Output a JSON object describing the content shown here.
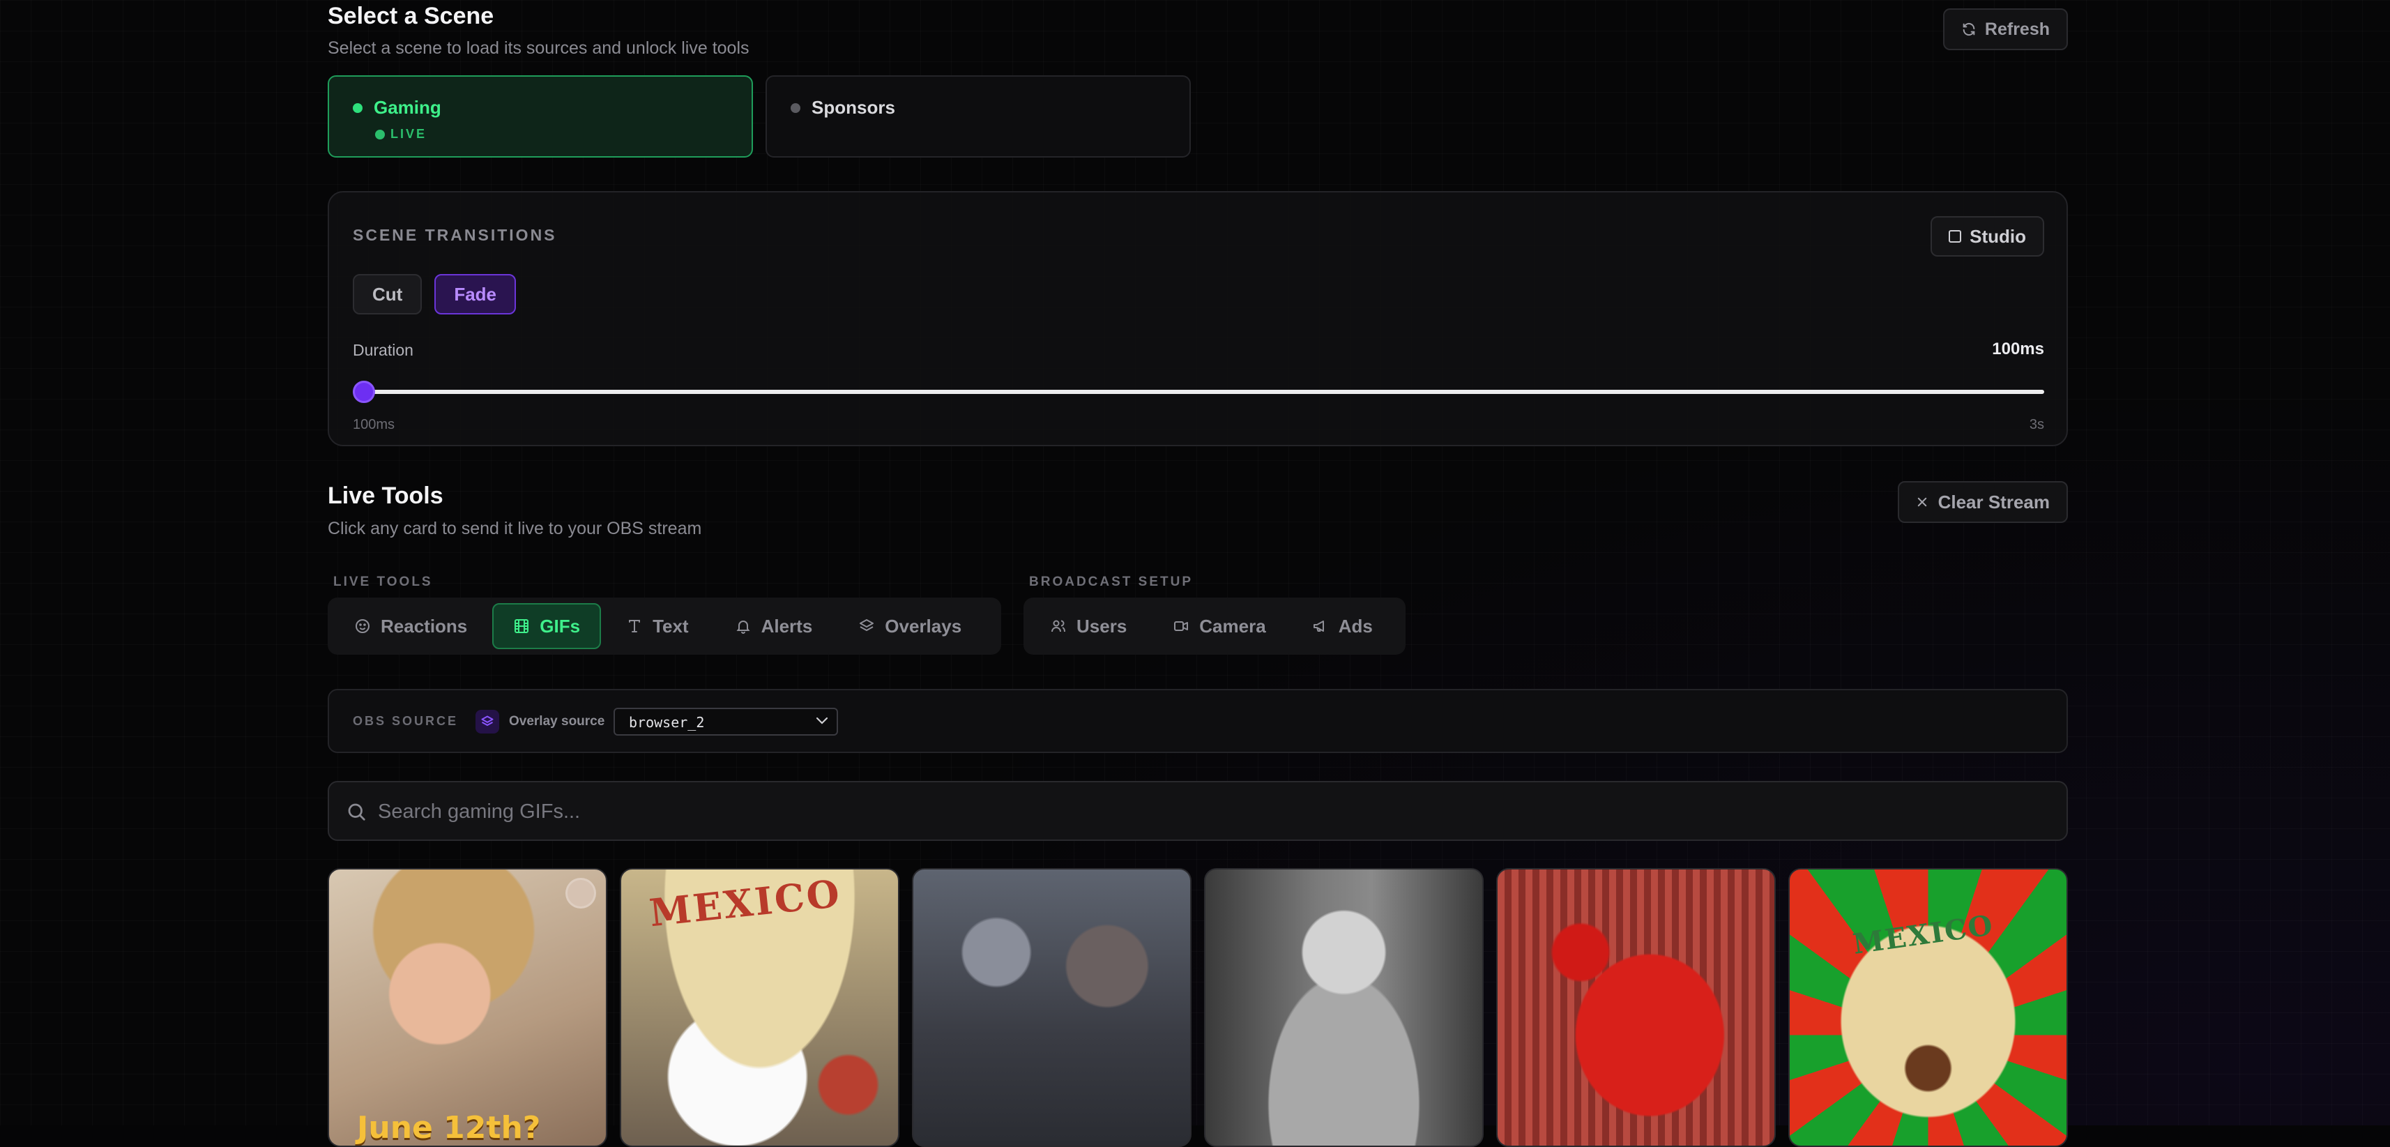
{
  "scene_section": {
    "title": "Select a Scene",
    "subtitle": "Select a scene to load its sources and unlock live tools",
    "refresh_label": "Refresh",
    "scenes": [
      {
        "name": "Gaming",
        "status": "LIVE",
        "active": true
      },
      {
        "name": "Sponsors",
        "status": "",
        "active": false
      }
    ]
  },
  "transitions": {
    "label": "SCENE TRANSITIONS",
    "studio_label": "Studio",
    "buttons": [
      "Cut",
      "Fade"
    ],
    "selected": "Fade",
    "duration_label": "Duration",
    "duration_value": "100ms",
    "min_label": "100ms",
    "max_label": "3s",
    "slider_fraction": 0
  },
  "live_tools": {
    "title": "Live Tools",
    "subtitle": "Click any card to send it live to your OBS stream",
    "clear_label": "Clear Stream",
    "group_live_label": "LIVE TOOLS",
    "group_broadcast_label": "BROADCAST SETUP",
    "live_tabs": [
      {
        "label": "Reactions",
        "icon": "smile-icon"
      },
      {
        "label": "GIFs",
        "icon": "film-icon"
      },
      {
        "label": "Text",
        "icon": "type-icon"
      },
      {
        "label": "Alerts",
        "icon": "bell-icon"
      },
      {
        "label": "Overlays",
        "icon": "layers-icon"
      }
    ],
    "active_tab": "GIFs",
    "broadcast_tabs": [
      {
        "label": "Users",
        "icon": "users-icon"
      },
      {
        "label": "Camera",
        "icon": "video-icon"
      },
      {
        "label": "Ads",
        "icon": "megaphone-icon"
      }
    ]
  },
  "obs_source": {
    "label": "OBS SOURCE",
    "overlay_label": "Overlay source",
    "selected_source": "browser_2"
  },
  "search": {
    "placeholder": "Search gaming GIFs...",
    "value": ""
  },
  "gifs": [
    {
      "caption": "June 12th?"
    },
    {
      "caption": "MEXICO"
    },
    {
      "caption": ""
    },
    {
      "caption": ""
    },
    {
      "caption": ""
    },
    {
      "caption": "MEXICO"
    }
  ],
  "colors": {
    "accent_green": "#3ff08b",
    "accent_purple": "#6d2ff2",
    "background": "#060607"
  }
}
